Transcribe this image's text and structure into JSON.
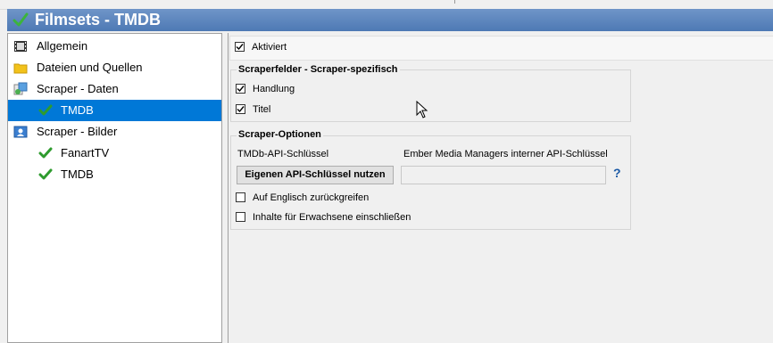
{
  "window": {
    "title": "Filmsets - TMDB"
  },
  "tree": {
    "items": [
      {
        "label": "Allgemein",
        "icon": "film-icon"
      },
      {
        "label": "Dateien und Quellen",
        "icon": "folder-icon"
      },
      {
        "label": "Scraper - Daten",
        "icon": "scraper-data-icon"
      },
      {
        "label": "TMDB",
        "icon": "check-icon",
        "selected": true
      },
      {
        "label": "Scraper - Bilder",
        "icon": "scraper-images-icon"
      },
      {
        "label": "FanartTV",
        "icon": "check-icon"
      },
      {
        "label": "TMDB",
        "icon": "check-icon"
      }
    ]
  },
  "settings": {
    "activated": {
      "label": "Aktiviert",
      "checked": true
    },
    "scraperfields": {
      "title": "Scraperfelder - Scraper-spezifisch",
      "items": [
        {
          "label": "Handlung",
          "checked": true
        },
        {
          "label": "Titel",
          "checked": true
        }
      ]
    },
    "options": {
      "title": "Scraper-Optionen",
      "api_key_label": "TMDb-API-Schlüssel",
      "internal_key_label": "Ember Media Managers interner API-Schlüssel",
      "use_own_key_button": "Eigenen API-Schlüssel nutzen",
      "api_key_value": "",
      "help_label": "?",
      "fallback_english": {
        "label": "Auf Englisch zurückgreifen",
        "checked": false
      },
      "adult_content": {
        "label": "Inhalte für Erwachsene einschließen",
        "checked": false
      }
    }
  },
  "colors": {
    "titlebar": "#5a82bc",
    "selection": "#0078d7",
    "check_green": "#2e9b2e"
  }
}
